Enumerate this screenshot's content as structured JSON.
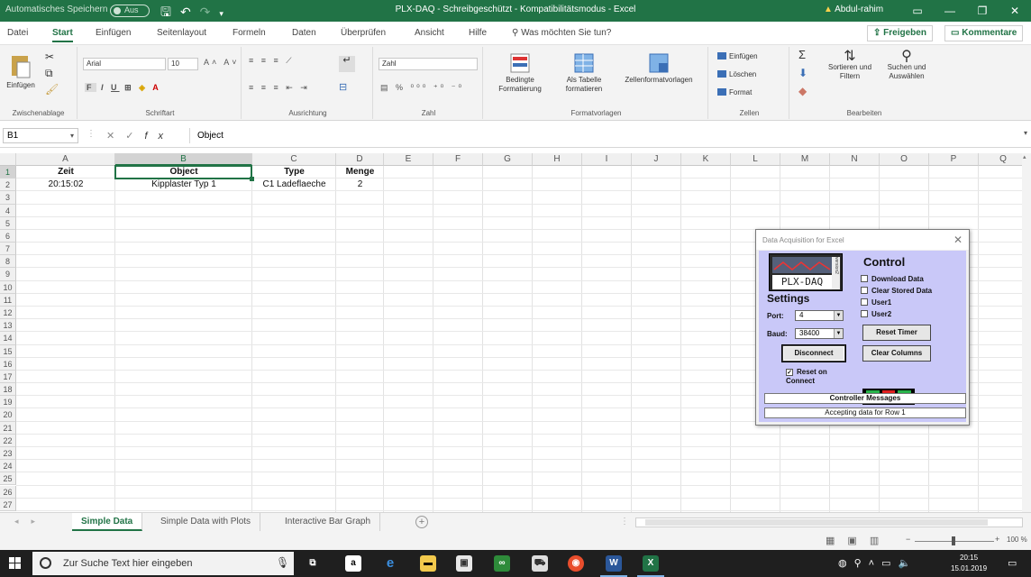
{
  "titlebar": {
    "autosave": "Automatisches Speichern",
    "autosave_state": "Aus",
    "title": "PLX-DAQ - Schreibgeschützt - Kompatibilitätsmodus - Excel",
    "user": "Abdul-rahim",
    "warning_icon": "warning-icon"
  },
  "menu": {
    "tabs": [
      "Datei",
      "Start",
      "Einfügen",
      "Seitenlayout",
      "Formeln",
      "Daten",
      "Überprüfen",
      "Ansicht",
      "Hilfe"
    ],
    "active": "Start",
    "tell_me": "Was möchten Sie tun?",
    "share": "Freigeben",
    "comments": "Kommentare"
  },
  "ribbon": {
    "clipboard": {
      "label": "Zwischenablage",
      "paste": "Einfügen"
    },
    "font": {
      "label": "Schriftart",
      "font_name": "Arial",
      "font_size": "10",
      "size_up": "A˄",
      "size_down": "A˅",
      "bold": "F",
      "italic": "I",
      "underline": "U",
      "font_color": "A"
    },
    "alignment": {
      "label": "Ausrichtung"
    },
    "number": {
      "label": "Zahl",
      "format": "Zahl"
    },
    "styles": {
      "label": "Formatvorlagen",
      "conditional": "Bedingte Formatierung",
      "as_table": "Als Tabelle formatieren",
      "cell_styles": "Zellenformatvorlagen"
    },
    "cells": {
      "label": "Zellen",
      "insert": "Einfügen",
      "delete": "Löschen",
      "format": "Format"
    },
    "editing": {
      "label": "Bearbeiten",
      "sort": "Sortieren und Filtern",
      "find": "Suchen und Auswählen"
    }
  },
  "formula_bar": {
    "name_box": "B1",
    "cancel": "✕",
    "enter": "✓",
    "fx": "fx",
    "value": "Object"
  },
  "grid": {
    "columns": [
      "A",
      "B",
      "C",
      "D",
      "E",
      "F",
      "G",
      "H",
      "I",
      "J",
      "K",
      "L",
      "M",
      "N",
      "O",
      "P",
      "Q"
    ],
    "row_count": 27,
    "rows": [
      [
        "Zeit",
        "Object",
        "Type",
        "Menge"
      ],
      [
        "20:15:02",
        "Kipplaster Typ 1",
        "C1 Ladeflaeche",
        "2"
      ]
    ]
  },
  "sheets": {
    "tabs": [
      "Simple Data",
      "Simple Data with Plots",
      "Interactive Bar Graph"
    ],
    "active": "Simple Data",
    "add": "+"
  },
  "status": {
    "zoom": "100 %",
    "zoom_level": 100
  },
  "dialog": {
    "title": "Data Acquisition for Excel",
    "close": "✕",
    "logo_text": "PLX-DAQ",
    "logo_side": "version2",
    "control_heading": "Control",
    "settings_heading": "Settings",
    "checkboxes": [
      "Download Data",
      "Clear Stored Data",
      "User1",
      "User2"
    ],
    "port_label": "Port:",
    "port_value": "4",
    "baud_label": "Baud:",
    "baud_value": "38400",
    "reset_timer": "Reset Timer",
    "disconnect": "Disconnect",
    "clear_columns": "Clear Columns",
    "reset_on_connect": "Reset on Connect",
    "leds": [
      "C",
      "R",
      "T"
    ],
    "controller_messages": "Controller Messages",
    "status_message": "Accepting data for Row 1",
    "colors": {
      "panel": "#c9c8f8",
      "led_c": "#27b24a",
      "led_r": "#e02020",
      "led_t": "#27b24a"
    }
  },
  "taskbar": {
    "search_placeholder": "Zur Suche Text hier eingeben",
    "time": "20:15",
    "date": "15.01.2019"
  },
  "colors": {
    "excel_green": "#217346"
  }
}
